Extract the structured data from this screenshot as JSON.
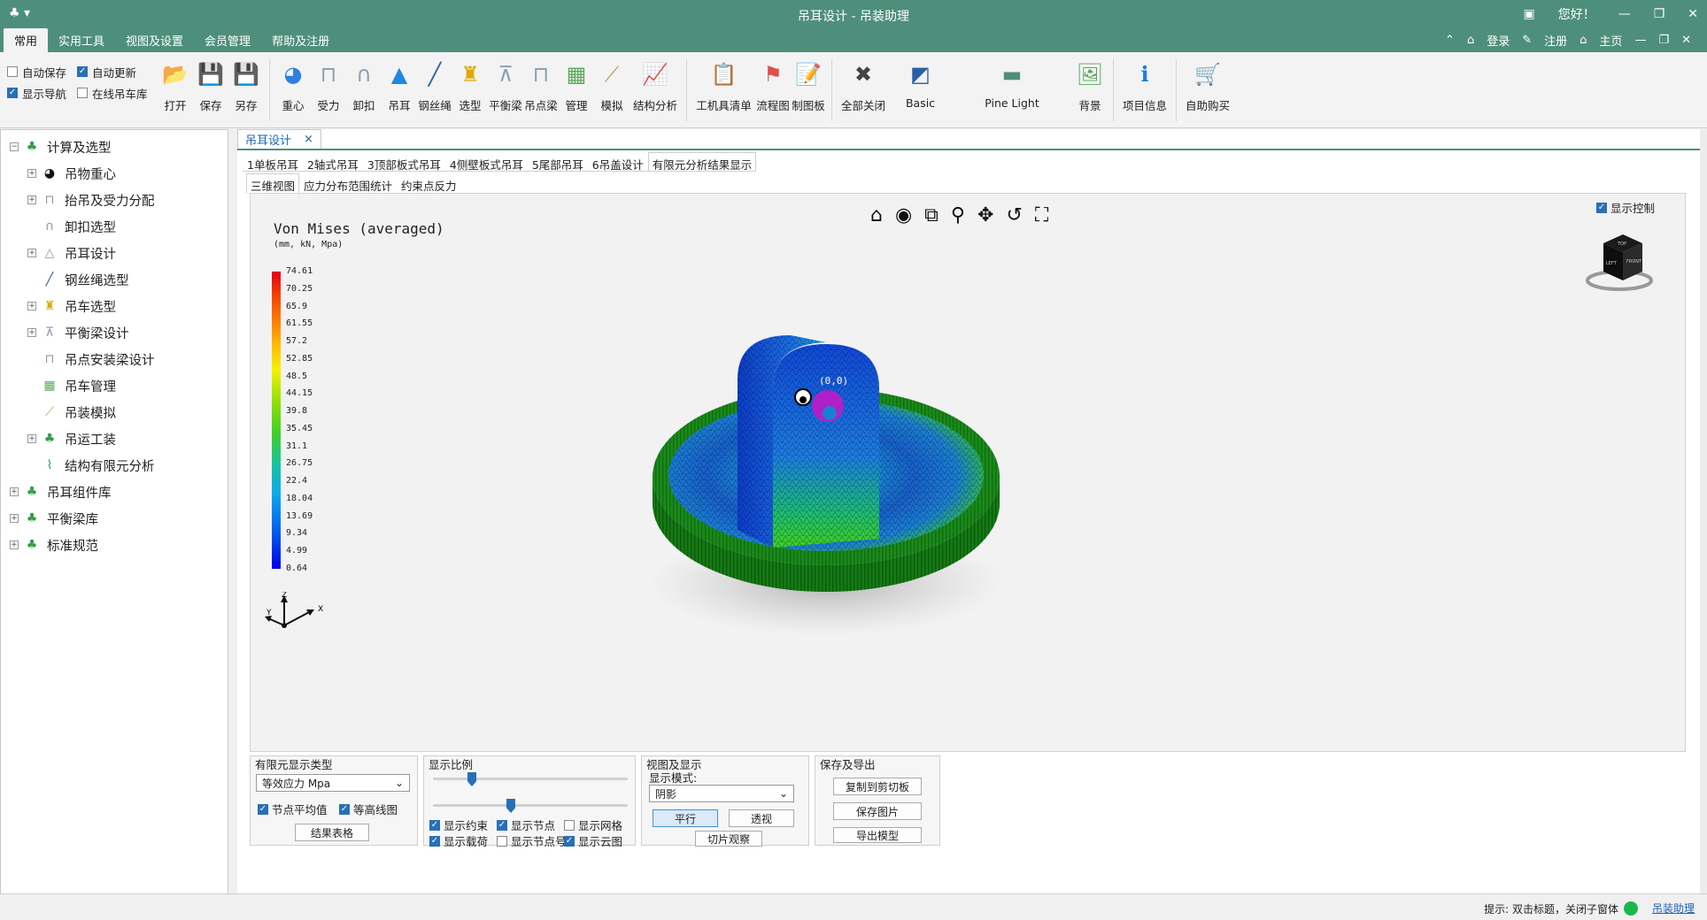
{
  "window": {
    "app_icon_label": "♣ ▾",
    "title": "吊耳设计 - 吊装助理",
    "greeting": "您好！",
    "controls": [
      "—",
      "❐",
      "✕"
    ]
  },
  "menu": {
    "tabs": [
      "常用",
      "实用工具",
      "视图及设置",
      "会员管理",
      "帮助及注册"
    ],
    "right": {
      "login": "登录",
      "register": "注册",
      "home": "主页"
    }
  },
  "ribbon": {
    "checks": [
      {
        "label": "自动保存",
        "checked": false
      },
      {
        "label": "自动更新",
        "checked": true
      },
      {
        "label": "显示导航",
        "checked": true
      },
      {
        "label": "在线吊车库",
        "checked": false
      }
    ],
    "groups": [
      [
        {
          "label": "打开",
          "icon": "folder-icon",
          "glyph": "📂",
          "color": "#e9a51a"
        },
        {
          "label": "保存",
          "icon": "save-icon",
          "glyph": "💾",
          "color": "#2b5fa8"
        },
        {
          "label": "另存",
          "icon": "save-as-icon",
          "glyph": "💾",
          "color": "#2b5fa8"
        }
      ],
      [
        {
          "label": "重心",
          "icon": "center-icon",
          "glyph": "◕",
          "color": "#2f7fe0"
        },
        {
          "label": "受力",
          "icon": "force-icon",
          "glyph": "⊓",
          "color": "#8aa0b4"
        },
        {
          "label": "卸扣",
          "icon": "shackle-icon",
          "glyph": "∩",
          "color": "#8aa0b4"
        },
        {
          "label": "吊耳",
          "icon": "lug-icon",
          "glyph": "▲",
          "color": "#1e88e5"
        },
        {
          "label": "钢丝绳",
          "icon": "rope-icon",
          "glyph": "╱",
          "color": "#2b5fa8"
        },
        {
          "label": "选型",
          "icon": "crane-icon",
          "glyph": "♜",
          "color": "#e0a800"
        },
        {
          "label": "平衡梁",
          "icon": "beam-icon",
          "glyph": "⊼",
          "color": "#8aa0b4"
        },
        {
          "label": "吊点梁",
          "icon": "point-beam-icon",
          "glyph": "⊓",
          "color": "#8aa0b4"
        },
        {
          "label": "管理",
          "icon": "manage-icon",
          "glyph": "▦",
          "color": "#5aa85a"
        },
        {
          "label": "模拟",
          "icon": "simulate-icon",
          "glyph": "⟋",
          "color": "#b8a060"
        },
        {
          "label": "结构分析",
          "icon": "analysis-icon",
          "glyph": "📈",
          "color": "#3a9a6a"
        }
      ],
      [
        {
          "label": "工机具清单",
          "icon": "list-icon",
          "glyph": "📋",
          "color": "#e3a92a"
        },
        {
          "label": "流程图",
          "icon": "flow-icon",
          "glyph": "⚑",
          "color": "#e05050"
        },
        {
          "label": "制图板",
          "icon": "board-icon",
          "glyph": "📝",
          "color": "#2b5fa8"
        }
      ],
      [
        {
          "label": "全部关闭",
          "icon": "close-all-icon",
          "glyph": "✖",
          "color": "#444444"
        },
        {
          "label": "Basic",
          "icon": "theme-basic-icon",
          "glyph": "◩",
          "color": "#2b5fa8"
        },
        {
          "label": "Pine Light",
          "icon": "theme-pine-icon",
          "glyph": "▬",
          "color": "#4e8f7b"
        },
        {
          "label": "背景",
          "icon": "background-icon",
          "glyph": "🖼",
          "color": "#5aa85a"
        }
      ],
      [
        {
          "label": "项目信息",
          "icon": "info-icon",
          "glyph": "ℹ",
          "color": "#1e7fd8"
        }
      ],
      [
        {
          "label": "自助购买",
          "icon": "cart-icon",
          "glyph": "🛒",
          "color": "#e05a2a"
        }
      ]
    ]
  },
  "tree": [
    {
      "label": "计算及选型",
      "level": 0,
      "expander": "−",
      "icon": "group-icon"
    },
    {
      "label": "吊物重心",
      "level": 1,
      "expander": "+",
      "icon": "center-icon"
    },
    {
      "label": "抬吊及受力分配",
      "level": 1,
      "expander": "+",
      "icon": "force-icon"
    },
    {
      "label": "卸扣选型",
      "level": 1,
      "expander": "",
      "icon": "shackle-icon"
    },
    {
      "label": "吊耳设计",
      "level": 1,
      "expander": "+",
      "icon": "lug-icon"
    },
    {
      "label": "钢丝绳选型",
      "level": 1,
      "expander": "",
      "icon": "rope-icon"
    },
    {
      "label": "吊车选型",
      "level": 1,
      "expander": "+",
      "icon": "crane-icon"
    },
    {
      "label": "平衡梁设计",
      "level": 1,
      "expander": "+",
      "icon": "beam-icon"
    },
    {
      "label": "吊点安装梁设计",
      "level": 1,
      "expander": "",
      "icon": "point-beam-icon"
    },
    {
      "label": "吊车管理",
      "level": 1,
      "expander": "",
      "icon": "manage-icon"
    },
    {
      "label": "吊装模拟",
      "level": 1,
      "expander": "",
      "icon": "simulate-icon"
    },
    {
      "label": "吊运工装",
      "level": 1,
      "expander": "+",
      "icon": "group-icon"
    },
    {
      "label": "结构有限元分析",
      "level": 1,
      "expander": "",
      "icon": "analysis-icon"
    },
    {
      "label": "吊耳组件库",
      "level": 0,
      "expander": "+",
      "icon": "group-icon"
    },
    {
      "label": "平衡梁库",
      "level": 0,
      "expander": "+",
      "icon": "group-icon"
    },
    {
      "label": "标准规范",
      "level": 0,
      "expander": "+",
      "icon": "group-icon"
    }
  ],
  "document": {
    "tab_label": "吊耳设计",
    "close_glyph": "×",
    "subtabs": [
      "1单板吊耳",
      "2轴式吊耳",
      "3顶部板式吊耳",
      "4侧壁板式吊耳",
      "5尾部吊耳",
      "6吊盖设计",
      "有限元分析结果显示"
    ],
    "active_subtab": 6,
    "view_tabs": [
      "三维视图",
      "应力分布范围统计",
      "约束点反力"
    ],
    "active_view_tab": 0
  },
  "viewer": {
    "tools": [
      "⌂",
      "◉",
      "⧉",
      "⚲",
      "✥",
      "↺",
      "⛶"
    ],
    "show_control": "显示控制",
    "result_title": "Von Mises (averaged)",
    "result_units": "(mm, kN, Mpa)",
    "legend_values": [
      "74.61",
      "70.25",
      "65.9",
      "61.55",
      "57.2",
      "52.85",
      "48.5",
      "44.15",
      "39.8",
      "35.45",
      "31.1",
      "26.75",
      "22.4",
      "18.04",
      "13.69",
      "9.34",
      "4.99",
      "0.64"
    ],
    "axis_labels": {
      "z": "Z",
      "x": "X",
      "y": "Y"
    },
    "node_label": "(0,0)",
    "cube_faces": {
      "top": "TOP",
      "left": "LEFT",
      "front": "FRONT"
    }
  },
  "controls": {
    "fe_type": {
      "title": "有限元显示类型",
      "value": "等效应力 Mpa",
      "node_avg": "节点平均值",
      "contour": "等高线图",
      "result_table": "结果表格"
    },
    "scale": {
      "title": "显示比例",
      "slider1": 0.2,
      "slider2": 0.4,
      "checks": [
        {
          "label": "显示约束",
          "checked": true
        },
        {
          "label": "显示节点",
          "checked": true
        },
        {
          "label": "显示网格",
          "checked": false
        },
        {
          "label": "显示载荷",
          "checked": true
        },
        {
          "label": "显示节点号",
          "checked": false
        },
        {
          "label": "显示云图",
          "checked": true
        }
      ]
    },
    "view": {
      "title": "视图及显示",
      "mode_label": "显示模式:",
      "mode_value": "阴影",
      "parallel": "平行",
      "perspective": "透视",
      "section": "切片观察"
    },
    "export": {
      "title": "保存及导出",
      "copy": "复制到剪切板",
      "save_image": "保存图片",
      "export_model": "导出模型"
    }
  },
  "status": {
    "hint": "提示: 双击标题，关闭子窗体",
    "app_link": "吊装助理"
  }
}
